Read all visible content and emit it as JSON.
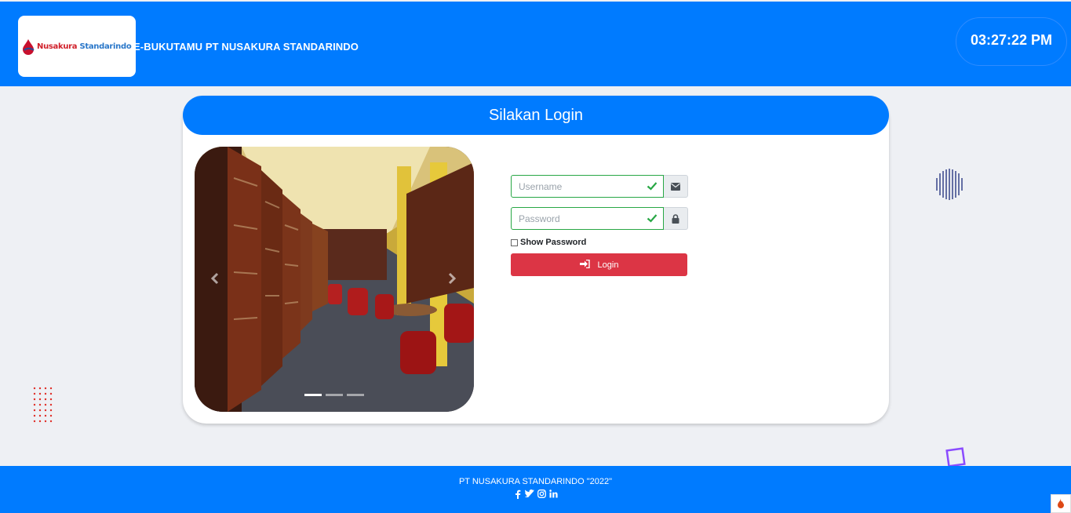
{
  "header": {
    "logo_text_red": "Nusakura",
    "logo_text_blue": "Standarindo",
    "title": "E-BUKUTAMU PT NUSAKURA STANDARINDO",
    "clock": "03:27:22 PM"
  },
  "card": {
    "heading": "Silakan Login"
  },
  "carousel": {
    "prev_icon": "chevron-left-icon",
    "next_icon": "chevron-right-icon",
    "indicator_count": 3,
    "active_index": 0
  },
  "form": {
    "username": {
      "placeholder": "Username",
      "value": "",
      "addon_icon": "envelope-icon"
    },
    "password": {
      "placeholder": "Password",
      "value": "",
      "addon_icon": "lock-icon"
    },
    "show_password_label": "Show Password",
    "show_password_checked": false,
    "login_label": "Login",
    "login_icon": "sign-in-icon"
  },
  "footer": {
    "text": "PT NUSAKURA STANDARINDO \"2022\"",
    "socials": [
      "facebook-icon",
      "twitter-icon",
      "instagram-icon",
      "linkedin-icon"
    ]
  },
  "colors": {
    "primary": "#007bff",
    "danger": "#dc3545",
    "success": "#28a745",
    "background": "#eef0f4"
  }
}
